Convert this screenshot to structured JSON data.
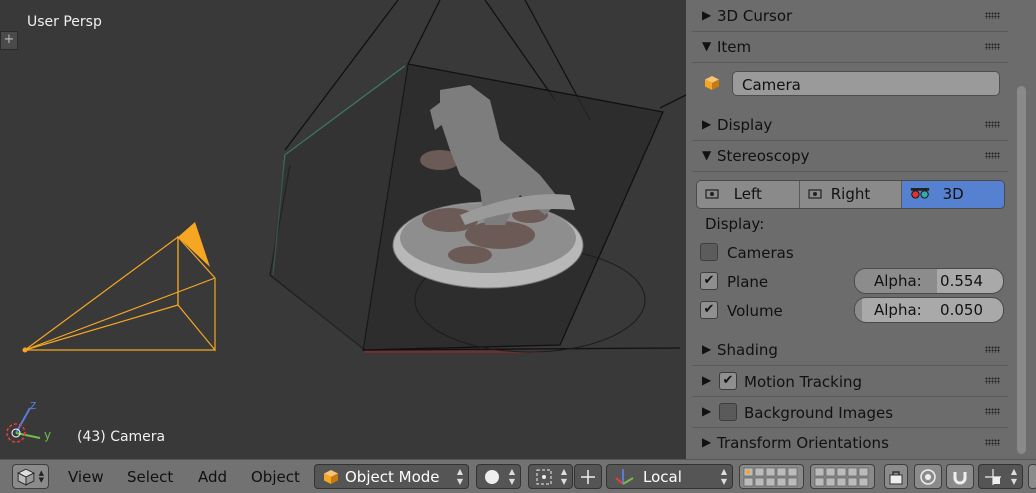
{
  "viewport": {
    "title": "User Persp",
    "plus_label": "+",
    "object_label": "(43) Camera",
    "axis_z": "z",
    "axis_y": "y"
  },
  "panel": {
    "sections": {
      "cursor": "3D Cursor",
      "item": "Item",
      "display": "Display",
      "stereoscopy": "Stereoscopy",
      "shading": "Shading",
      "motion_tracking": "Motion Tracking",
      "background_images": "Background Images",
      "transform_orientations": "Transform Orientations"
    },
    "item_name": "Camera",
    "stereo_buttons": {
      "left": "Left",
      "right": "Right",
      "three_d": "3D"
    },
    "stereo_active": "3D",
    "display_label": "Display:",
    "cameras_label": "Cameras",
    "plane_label": "Plane",
    "volume_label": "Volume",
    "alpha_label": "Alpha:",
    "plane_alpha": "0.554",
    "volume_alpha": "0.050",
    "cameras_checked": false,
    "plane_checked": true,
    "volume_checked": true,
    "motion_tracking_checked": true,
    "background_images_checked": false,
    "check_glyph": "✔"
  },
  "header": {
    "menus": {
      "view": "View",
      "select": "Select",
      "add": "Add",
      "object": "Object"
    },
    "mode": "Object Mode",
    "pivot": "Local",
    "arrows": "▲▼"
  },
  "colors": {
    "viewport_bg": "#393939",
    "panel_bg": "#6c6c6c",
    "accent_active": "#5681d0",
    "camera_selected": "#f5a623"
  },
  "icons": [
    "cube-icon",
    "camera-icon",
    "stereo-3d-icon",
    "sphere-shading-icon",
    "manipulator-icon",
    "layers-icon",
    "lock-icon",
    "snap-icon"
  ]
}
